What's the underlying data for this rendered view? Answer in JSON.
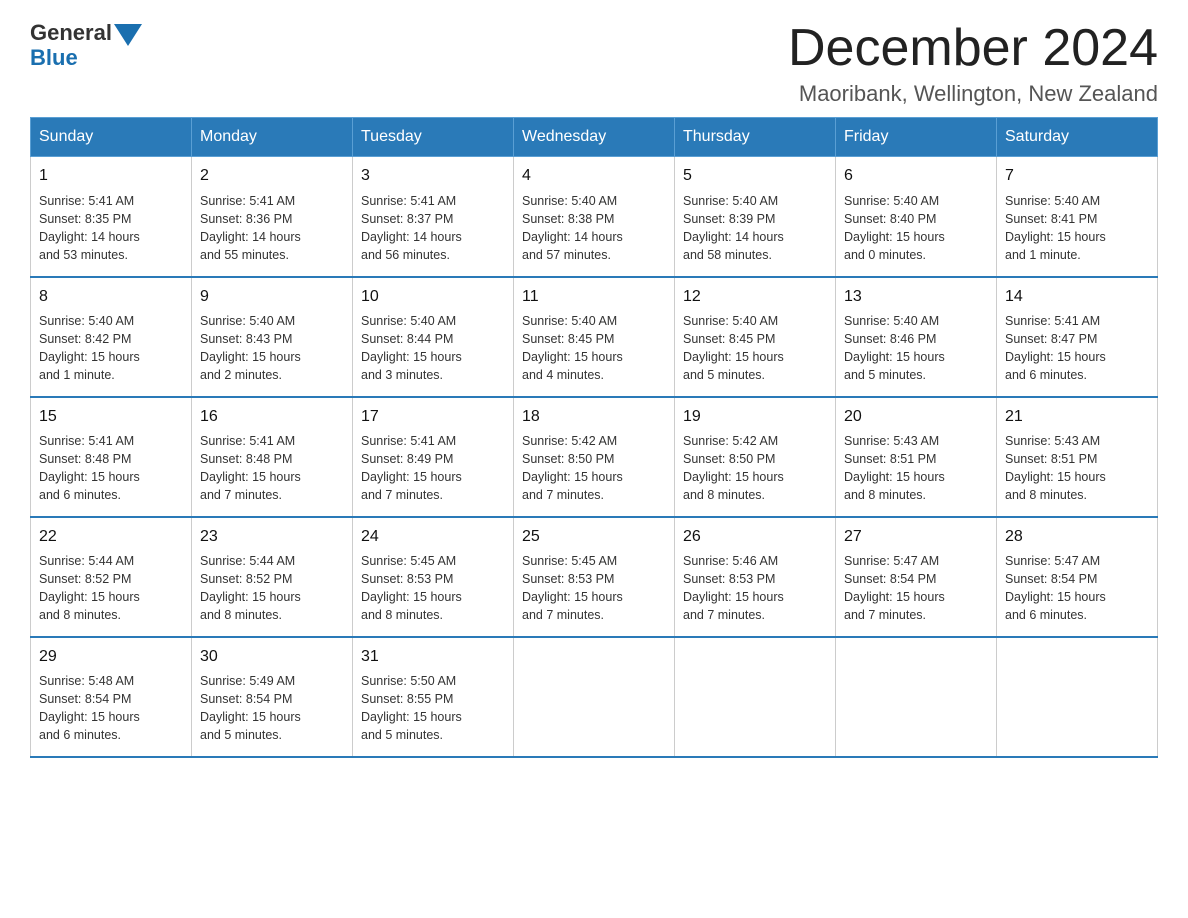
{
  "header": {
    "logo_general": "General",
    "logo_blue": "Blue",
    "title": "December 2024",
    "subtitle": "Maoribank, Wellington, New Zealand"
  },
  "weekdays": [
    "Sunday",
    "Monday",
    "Tuesday",
    "Wednesday",
    "Thursday",
    "Friday",
    "Saturday"
  ],
  "weeks": [
    [
      {
        "day": "1",
        "info": "Sunrise: 5:41 AM\nSunset: 8:35 PM\nDaylight: 14 hours\nand 53 minutes."
      },
      {
        "day": "2",
        "info": "Sunrise: 5:41 AM\nSunset: 8:36 PM\nDaylight: 14 hours\nand 55 minutes."
      },
      {
        "day": "3",
        "info": "Sunrise: 5:41 AM\nSunset: 8:37 PM\nDaylight: 14 hours\nand 56 minutes."
      },
      {
        "day": "4",
        "info": "Sunrise: 5:40 AM\nSunset: 8:38 PM\nDaylight: 14 hours\nand 57 minutes."
      },
      {
        "day": "5",
        "info": "Sunrise: 5:40 AM\nSunset: 8:39 PM\nDaylight: 14 hours\nand 58 minutes."
      },
      {
        "day": "6",
        "info": "Sunrise: 5:40 AM\nSunset: 8:40 PM\nDaylight: 15 hours\nand 0 minutes."
      },
      {
        "day": "7",
        "info": "Sunrise: 5:40 AM\nSunset: 8:41 PM\nDaylight: 15 hours\nand 1 minute."
      }
    ],
    [
      {
        "day": "8",
        "info": "Sunrise: 5:40 AM\nSunset: 8:42 PM\nDaylight: 15 hours\nand 1 minute."
      },
      {
        "day": "9",
        "info": "Sunrise: 5:40 AM\nSunset: 8:43 PM\nDaylight: 15 hours\nand 2 minutes."
      },
      {
        "day": "10",
        "info": "Sunrise: 5:40 AM\nSunset: 8:44 PM\nDaylight: 15 hours\nand 3 minutes."
      },
      {
        "day": "11",
        "info": "Sunrise: 5:40 AM\nSunset: 8:45 PM\nDaylight: 15 hours\nand 4 minutes."
      },
      {
        "day": "12",
        "info": "Sunrise: 5:40 AM\nSunset: 8:45 PM\nDaylight: 15 hours\nand 5 minutes."
      },
      {
        "day": "13",
        "info": "Sunrise: 5:40 AM\nSunset: 8:46 PM\nDaylight: 15 hours\nand 5 minutes."
      },
      {
        "day": "14",
        "info": "Sunrise: 5:41 AM\nSunset: 8:47 PM\nDaylight: 15 hours\nand 6 minutes."
      }
    ],
    [
      {
        "day": "15",
        "info": "Sunrise: 5:41 AM\nSunset: 8:48 PM\nDaylight: 15 hours\nand 6 minutes."
      },
      {
        "day": "16",
        "info": "Sunrise: 5:41 AM\nSunset: 8:48 PM\nDaylight: 15 hours\nand 7 minutes."
      },
      {
        "day": "17",
        "info": "Sunrise: 5:41 AM\nSunset: 8:49 PM\nDaylight: 15 hours\nand 7 minutes."
      },
      {
        "day": "18",
        "info": "Sunrise: 5:42 AM\nSunset: 8:50 PM\nDaylight: 15 hours\nand 7 minutes."
      },
      {
        "day": "19",
        "info": "Sunrise: 5:42 AM\nSunset: 8:50 PM\nDaylight: 15 hours\nand 8 minutes."
      },
      {
        "day": "20",
        "info": "Sunrise: 5:43 AM\nSunset: 8:51 PM\nDaylight: 15 hours\nand 8 minutes."
      },
      {
        "day": "21",
        "info": "Sunrise: 5:43 AM\nSunset: 8:51 PM\nDaylight: 15 hours\nand 8 minutes."
      }
    ],
    [
      {
        "day": "22",
        "info": "Sunrise: 5:44 AM\nSunset: 8:52 PM\nDaylight: 15 hours\nand 8 minutes."
      },
      {
        "day": "23",
        "info": "Sunrise: 5:44 AM\nSunset: 8:52 PM\nDaylight: 15 hours\nand 8 minutes."
      },
      {
        "day": "24",
        "info": "Sunrise: 5:45 AM\nSunset: 8:53 PM\nDaylight: 15 hours\nand 8 minutes."
      },
      {
        "day": "25",
        "info": "Sunrise: 5:45 AM\nSunset: 8:53 PM\nDaylight: 15 hours\nand 7 minutes."
      },
      {
        "day": "26",
        "info": "Sunrise: 5:46 AM\nSunset: 8:53 PM\nDaylight: 15 hours\nand 7 minutes."
      },
      {
        "day": "27",
        "info": "Sunrise: 5:47 AM\nSunset: 8:54 PM\nDaylight: 15 hours\nand 7 minutes."
      },
      {
        "day": "28",
        "info": "Sunrise: 5:47 AM\nSunset: 8:54 PM\nDaylight: 15 hours\nand 6 minutes."
      }
    ],
    [
      {
        "day": "29",
        "info": "Sunrise: 5:48 AM\nSunset: 8:54 PM\nDaylight: 15 hours\nand 6 minutes."
      },
      {
        "day": "30",
        "info": "Sunrise: 5:49 AM\nSunset: 8:54 PM\nDaylight: 15 hours\nand 5 minutes."
      },
      {
        "day": "31",
        "info": "Sunrise: 5:50 AM\nSunset: 8:55 PM\nDaylight: 15 hours\nand 5 minutes."
      },
      null,
      null,
      null,
      null
    ]
  ]
}
